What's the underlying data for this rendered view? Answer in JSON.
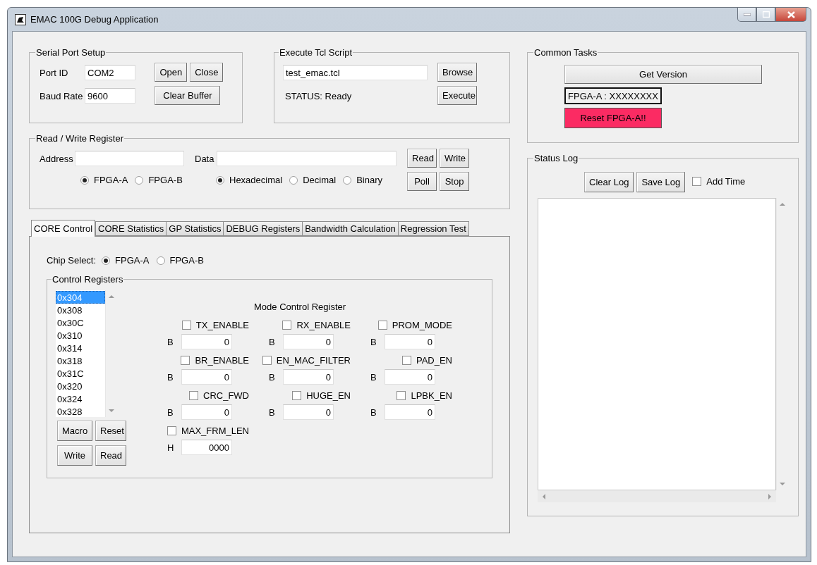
{
  "window": {
    "title": "EMAC 100G Debug Application"
  },
  "serial_port": {
    "title": "Serial Port Setup",
    "fields": [
      {
        "label": "Port ID",
        "value": "COM2"
      },
      {
        "label": "Baud Rate",
        "value": "9600"
      }
    ],
    "buttons": [
      "Open",
      "Close",
      "Clear Buffer"
    ]
  },
  "tcl_script": {
    "title": "Execute Tcl Script",
    "value": "test_emac.tcl",
    "status": "STATUS: Ready",
    "buttons": [
      "Browse",
      "Execute"
    ]
  },
  "read_write": {
    "title": "Read / Write Register",
    "address_label": "Address",
    "data_label": "Data",
    "chips": [
      {
        "label": "FPGA-A",
        "selected": true
      },
      {
        "label": "FPGA-B",
        "selected": false
      }
    ],
    "formats": [
      {
        "label": "Hexadecimal",
        "selected": true
      },
      {
        "label": "Decimal",
        "selected": false
      },
      {
        "label": "Binary",
        "selected": false
      }
    ],
    "buttons": [
      "Read",
      "Write",
      "Poll",
      "Stop"
    ]
  },
  "tabs": [
    {
      "label": "CORE Control",
      "selected": true
    },
    {
      "label": "CORE Statistics",
      "selected": false
    },
    {
      "label": "GP Statistics",
      "selected": false
    },
    {
      "label": "DEBUG Registers",
      "selected": false
    },
    {
      "label": "Bandwidth Calculation",
      "selected": false
    },
    {
      "label": "Regression Test",
      "selected": false
    }
  ],
  "core_control": {
    "chip_select_label": "Chip Select:",
    "chips": [
      {
        "label": "FPGA-A",
        "selected": true
      },
      {
        "label": "FPGA-B",
        "selected": false
      }
    ],
    "registers_title": "Control Registers",
    "registers": [
      {
        "label": "0x304",
        "selected": true
      },
      {
        "label": "0x308",
        "selected": false
      },
      {
        "label": "0x30C",
        "selected": false
      },
      {
        "label": "0x310",
        "selected": false
      },
      {
        "label": "0x314",
        "selected": false
      },
      {
        "label": "0x318",
        "selected": false
      },
      {
        "label": "0x31C",
        "selected": false
      },
      {
        "label": "0x320",
        "selected": false
      },
      {
        "label": "0x324",
        "selected": false
      },
      {
        "label": "0x328",
        "selected": false
      }
    ],
    "buttons": [
      "Macro",
      "Reset",
      "Write",
      "Read"
    ],
    "mode_title": "Mode Control Register",
    "flags": [
      {
        "label": "TX_ENABLE",
        "checked": false,
        "prefix": "B",
        "value": "0"
      },
      {
        "label": "RX_ENABLE",
        "checked": false,
        "prefix": "B",
        "value": "0"
      },
      {
        "label": "PROM_MODE",
        "checked": false,
        "prefix": "B",
        "value": "0"
      },
      {
        "label": "BR_ENABLE",
        "checked": false,
        "prefix": "B",
        "value": "0"
      },
      {
        "label": "EN_MAC_FILTER",
        "checked": false,
        "prefix": "B",
        "value": "0"
      },
      {
        "label": "PAD_EN",
        "checked": false,
        "prefix": "B",
        "value": "0"
      },
      {
        "label": "CRC_FWD",
        "checked": false,
        "prefix": "B",
        "value": "0"
      },
      {
        "label": "HUGE_EN",
        "checked": false,
        "prefix": "B",
        "value": "0"
      },
      {
        "label": "LPBK_EN",
        "checked": false,
        "prefix": "B",
        "value": "0"
      },
      {
        "label": "MAX_FRM_LEN",
        "checked": false,
        "prefix": "H",
        "value": "0000"
      }
    ]
  },
  "common_tasks": {
    "title": "Common Tasks",
    "get_version": "Get Version",
    "version": "FPGA-A : XXXXXXXX",
    "reset": "Reset FPGA-A!!"
  },
  "status_log": {
    "title": "Status Log",
    "buttons": [
      "Clear Log",
      "Save Log"
    ],
    "add_time": {
      "label": "Add Time",
      "checked": false
    }
  }
}
